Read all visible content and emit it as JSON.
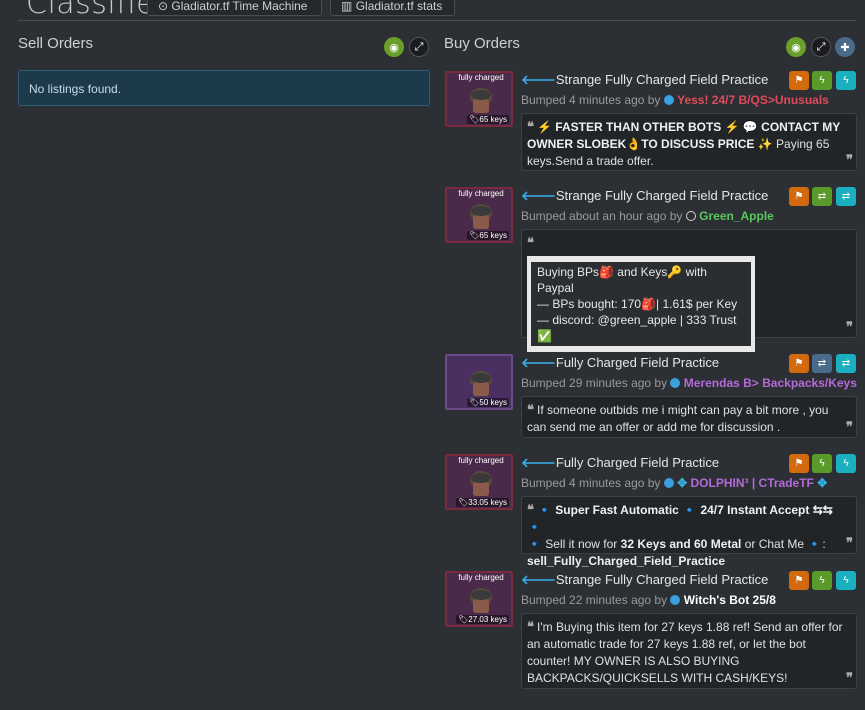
{
  "header": {
    "title": "Classifieds",
    "time_machine_label": "Gladiator.tf Time Machine",
    "stats_label": "Gladiator.tf stats"
  },
  "sell": {
    "title": "Sell Orders",
    "empty_message": "No listings found."
  },
  "buy": {
    "title": "Buy Orders"
  },
  "listings": [
    {
      "effect": "fully charged",
      "price": "65 keys",
      "title": "Strange Fully Charged Field Practice",
      "bumped": "Bumped 4 minutes ago by",
      "user": "Yess! 24/7 B/QS>Unusuals",
      "user_color": "#e04b5a",
      "dot_color": "#3aa0e0",
      "msg_1": "⚡ FASTER THAN OTHER BOTS ⚡ 💬 CONTACT MY OWNER SLOBEK👌TO DISCUSS PRICE ✨",
      "msg_2": " Paying 65 keys.Send a trade offer."
    },
    {
      "effect": "fully charged",
      "price": "65 keys",
      "title": "Strange Fully Charged Field Practice",
      "bumped": "Bumped about an hour ago by",
      "user": "Green_Apple",
      "user_color": "#5ac85a",
      "dot_color": "#2c2f33",
      "ascii_1": "Buying BPs🎒 and Keys🔑 with Paypal",
      "ascii_2": "— BPs bought: 170🎒| 1.61$ per Key",
      "ascii_3": "— discord: @green_apple | 333 Trust ✅"
    },
    {
      "effect": "",
      "price": "50 keys",
      "title": "Fully Charged Field Practice",
      "bumped": "Bumped 29 minutes ago by",
      "user": "Merendas B> Backpacks/Keys",
      "user_color": "#b46ad8",
      "dot_color": "#3aa0e0",
      "msg": "If someone outbids me i might can pay a bit more , you can send me an offer or add me for discussion ."
    },
    {
      "effect": "fully charged",
      "price": "33.05 keys",
      "title": "Fully Charged Field Practice",
      "bumped": "Bumped 4 minutes ago by",
      "user": "DOLPHIN³ | CTradeTF",
      "user_color": "#b46ad8",
      "dot_color": "#3aa0e0",
      "msg_1": "🔹 Super Fast Automatic 🔹 24/7 Instant Accept ⇆⇆ 🔹",
      "msg_2": "🔹 Sell it now for ",
      "msg_3": "32 Keys and 60 Metal",
      "msg_4": " or Chat Me 🔹:",
      "msg_5": "sell_Fully_Charged_Field_Practice"
    },
    {
      "effect": "fully charged",
      "price": "27.03 keys",
      "title": "Strange Fully Charged Field Practice",
      "bumped": "Bumped 22 minutes ago by",
      "user": "Witch's Bot 25/8",
      "user_color": "#ffffff",
      "dot_color": "#3aa0e0",
      "msg": "I'm Buying this item for 27 keys 1.88 ref! Send an offer for an automatic trade for 27 keys 1.88 ref, or let the bot counter! MY OWNER IS ALSO BUYING BACKPACKS/QUICKSELLS WITH CASH/KEYS!"
    }
  ],
  "colors": {
    "flag": "#d46a0e",
    "lightning": "#5a9a2a",
    "cyan": "#1ab0c0",
    "swap": "#4a6a8a",
    "eye": "#6aa02a"
  }
}
